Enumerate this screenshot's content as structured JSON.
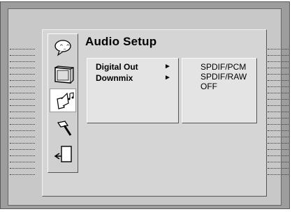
{
  "screen": {
    "title": "Audio Setup"
  },
  "sidebar": {
    "icons": [
      {
        "name": "speech-bubble-icon",
        "active": false
      },
      {
        "name": "tv-screen-icon",
        "active": false
      },
      {
        "name": "speaker-music-icon",
        "active": true
      },
      {
        "name": "hammer-icon",
        "active": false
      },
      {
        "name": "exit-door-icon",
        "active": false
      }
    ]
  },
  "menu": {
    "items": [
      {
        "label": "Digital Out",
        "arrow": "►"
      },
      {
        "label": "Downmix",
        "arrow": "►"
      }
    ]
  },
  "options": {
    "items": [
      "SPDIF/PCM",
      "SPDIF/RAW",
      "OFF"
    ]
  },
  "colors": {
    "bezel": "#9d9d9d",
    "screen": "#c8c8c8",
    "panel": "#d5d5d5",
    "highlight": "#ffffff"
  }
}
